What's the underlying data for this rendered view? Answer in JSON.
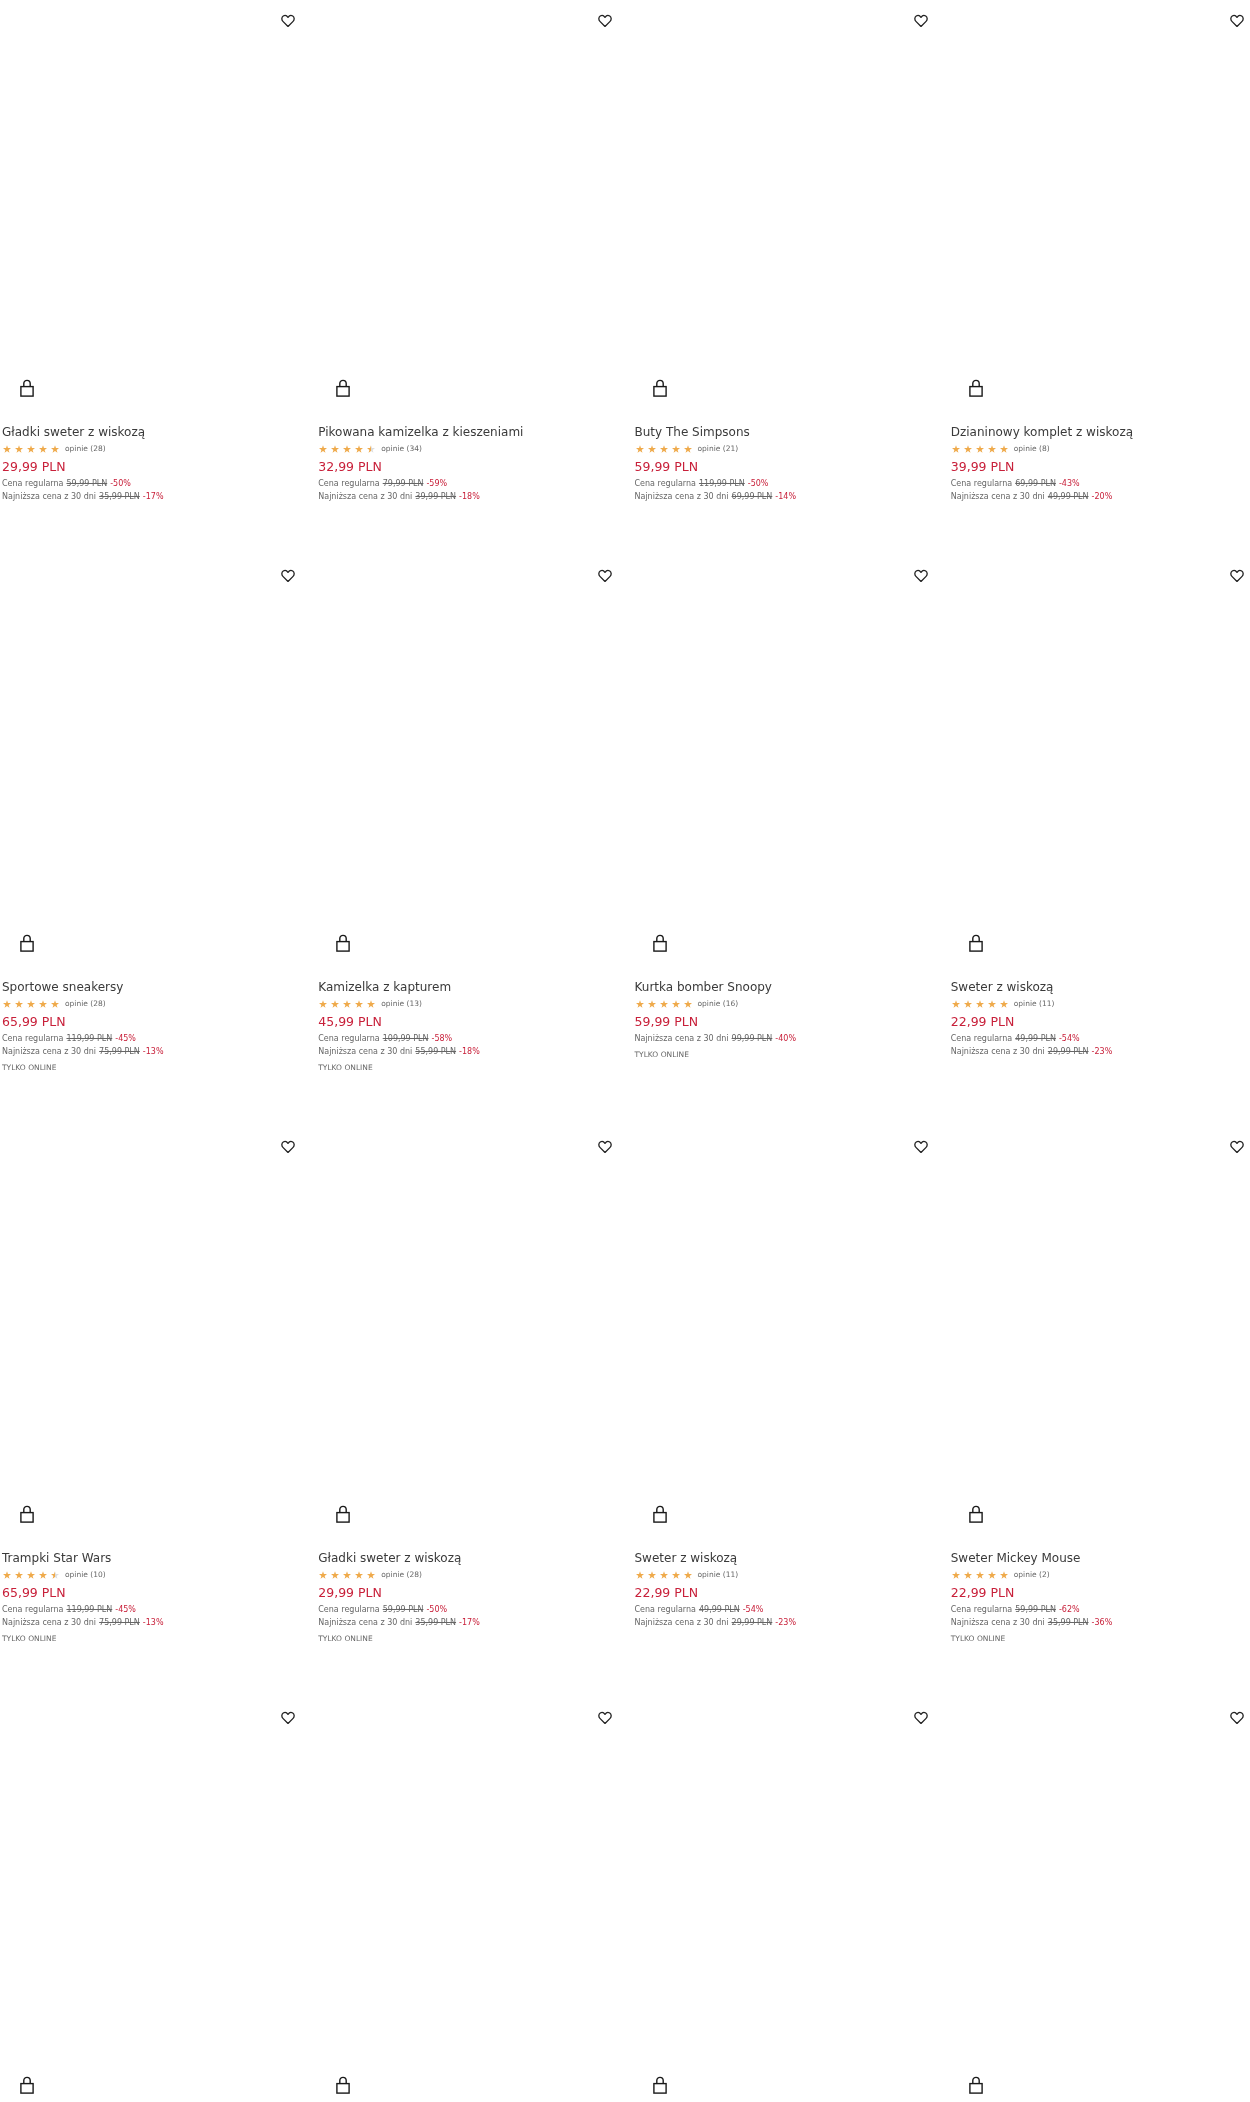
{
  "products": [
    {
      "title": "Gładki sweter z wiskozą",
      "stars": 5,
      "reviews": "opinie (28)",
      "price": "29,99 PLN",
      "price_notes": [
        {
          "label": "Cena regularna",
          "old_price": "59,99 PLN",
          "discount": "-50%"
        },
        {
          "label": "Najniższa cena z 30 dni",
          "old_price": "35,99 PLN",
          "discount": "-17%"
        }
      ],
      "wishlisted": false
    },
    {
      "title": "Pikowana kamizelka z kieszeniami",
      "stars": 4.5,
      "reviews": "opinie (34)",
      "price": "32,99 PLN",
      "price_notes": [
        {
          "label": "Cena regularna",
          "old_price": "79,99 PLN",
          "discount": "-59%"
        },
        {
          "label": "Najniższa cena z 30 dni",
          "old_price": "39,99 PLN",
          "discount": "-18%"
        }
      ],
      "wishlisted": false
    },
    {
      "title": "Buty The Simpsons",
      "stars": 5,
      "reviews": "opinie (21)",
      "price": "59,99 PLN",
      "price_notes": [
        {
          "label": "Cena regularna",
          "old_price": "119,99 PLN",
          "discount": "-50%"
        },
        {
          "label": "Najniższa cena z 30 dni",
          "old_price": "69,99 PLN",
          "discount": "-14%"
        }
      ],
      "wishlisted": false
    },
    {
      "title": "Dzianinowy komplet z wiskozą",
      "stars": 5,
      "reviews": "opinie (8)",
      "price": "39,99 PLN",
      "price_notes": [
        {
          "label": "Cena regularna",
          "old_price": "69,99 PLN",
          "discount": "-43%"
        },
        {
          "label": "Najniższa cena z 30 dni",
          "old_price": "49,99 PLN",
          "discount": "-20%"
        }
      ],
      "wishlisted": false
    },
    {
      "title": "Sportowe sneakersy",
      "stars": 5,
      "reviews": "opinie (28)",
      "price": "65,99 PLN",
      "price_notes": [
        {
          "label": "Cena regularna",
          "old_price": "119,99 PLN",
          "discount": "-45%"
        },
        {
          "label": "Najniższa cena z 30 dni",
          "old_price": "75,99 PLN",
          "discount": "-13%"
        }
      ],
      "badge": "TYLKO ONLINE",
      "wishlisted": false
    },
    {
      "title": "Kamizelka z kapturem",
      "stars": 5,
      "reviews": "opinie (13)",
      "price": "45,99 PLN",
      "price_notes": [
        {
          "label": "Cena regularna",
          "old_price": "109,99 PLN",
          "discount": "-58%"
        },
        {
          "label": "Najniższa cena z 30 dni",
          "old_price": "55,99 PLN",
          "discount": "-18%"
        }
      ],
      "badge": "TYLKO ONLINE",
      "wishlisted": false
    },
    {
      "title": "Kurtka bomber Snoopy",
      "stars": 5,
      "reviews": "opinie (16)",
      "price": "59,99 PLN",
      "price_notes": [
        {
          "label": "Najniższa cena z 30 dni",
          "old_price": "99,99 PLN",
          "discount": "-40%"
        }
      ],
      "badge": "TYLKO ONLINE",
      "wishlisted": false
    },
    {
      "title": "Sweter z wiskozą",
      "stars": 5,
      "reviews": "opinie (11)",
      "price": "22,99 PLN",
      "price_notes": [
        {
          "label": "Cena regularna",
          "old_price": "49,99 PLN",
          "discount": "-54%"
        },
        {
          "label": "Najniższa cena z 30 dni",
          "old_price": "29,99 PLN",
          "discount": "-23%"
        }
      ],
      "wishlisted": false
    },
    {
      "title": "Trampki Star Wars",
      "stars": 4.5,
      "reviews": "opinie (10)",
      "price": "65,99 PLN",
      "price_notes": [
        {
          "label": "Cena regularna",
          "old_price": "119,99 PLN",
          "discount": "-45%"
        },
        {
          "label": "Najniższa cena z 30 dni",
          "old_price": "75,99 PLN",
          "discount": "-13%"
        }
      ],
      "badge": "TYLKO ONLINE",
      "wishlisted": false
    },
    {
      "title": "Gładki sweter z wiskozą",
      "stars": 5,
      "reviews": "opinie (28)",
      "price": "29,99 PLN",
      "price_notes": [
        {
          "label": "Cena regularna",
          "old_price": "59,99 PLN",
          "discount": "-50%"
        },
        {
          "label": "Najniższa cena z 30 dni",
          "old_price": "35,99 PLN",
          "discount": "-17%"
        }
      ],
      "badge": "TYLKO ONLINE",
      "wishlisted": false
    },
    {
      "title": "Sweter z wiskozą",
      "stars": 5,
      "reviews": "opinie (11)",
      "price": "22,99 PLN",
      "price_notes": [
        {
          "label": "Cena regularna",
          "old_price": "49,99 PLN",
          "discount": "-54%"
        },
        {
          "label": "Najniższa cena z 30 dni",
          "old_price": "29,99 PLN",
          "discount": "-23%"
        }
      ],
      "wishlisted": false
    },
    {
      "title": "Sweter Mickey Mouse",
      "stars": 5,
      "reviews": "opinie (2)",
      "price": "22,99 PLN",
      "price_notes": [
        {
          "label": "Cena regularna",
          "old_price": "59,99 PLN",
          "discount": "-62%"
        },
        {
          "label": "Najniższa cena z 30 dni",
          "old_price": "35,99 PLN",
          "discount": "-36%"
        }
      ],
      "badge": "TYLKO ONLINE",
      "wishlisted": false
    },
    {
      "wishlisted": false
    },
    {
      "wishlisted": false
    },
    {
      "wishlisted": false
    },
    {
      "wishlisted": false
    }
  ]
}
